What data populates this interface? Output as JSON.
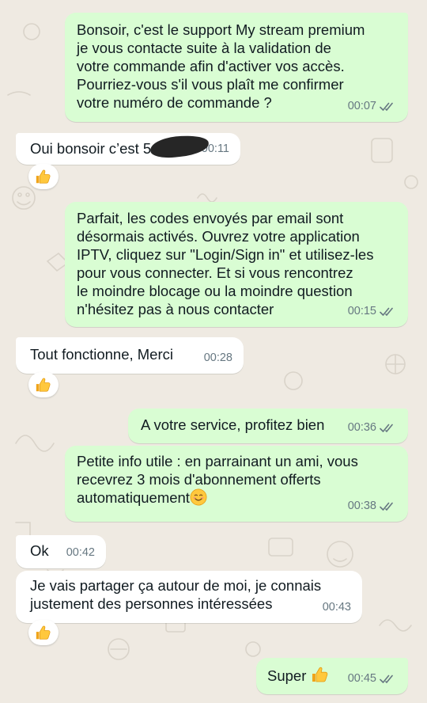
{
  "conversation": {
    "messages": [
      {
        "direction": "outgoing",
        "text": "Bonsoir, c'est le support My stream premium\nje vous contacte suite à la validation de\nvotre commande afin d'activer vos accès.\nPourriez-vous s'il vous plaît me confirmer\nvotre numéro de commande ?",
        "time": "00:07",
        "status": "read"
      },
      {
        "direction": "incoming",
        "text": "Oui bonsoir c’est 5",
        "time": "00:11",
        "reaction": "thumbs-up",
        "redacted": true
      },
      {
        "direction": "outgoing",
        "text": "Parfait, les codes envoyés par email sont\ndésormais activés. Ouvrez votre application\nIPTV, cliquez sur \"Login/Sign in\" et utilisez-les\npour vous connecter. Et si vous rencontrez\nle moindre blocage ou la moindre question\nn'hésitez pas à nous contacter",
        "time": "00:15",
        "status": "read"
      },
      {
        "direction": "incoming",
        "text": "Tout fonctionne, Merci",
        "time": "00:28",
        "reaction": "thumbs-up"
      },
      {
        "direction": "outgoing",
        "text": "A votre service, profitez bien",
        "time": "00:36",
        "status": "read"
      },
      {
        "direction": "outgoing",
        "text": "Petite info utile : en parrainant un ami, vous\nrecevrez 3 mois d'abonnement offerts\nautomatiquement",
        "time": "00:38",
        "status": "read",
        "trailing_emoji": "smiling-face-emoji"
      },
      {
        "direction": "incoming",
        "text": "Ok",
        "time": "00:42"
      },
      {
        "direction": "incoming",
        "text": "Je vais partager ça autour de moi, je connais\njustement des personnes intéressées",
        "time": "00:43",
        "reaction": "thumbs-up"
      },
      {
        "direction": "outgoing",
        "text": "Super",
        "time": "00:45",
        "status": "read",
        "trailing_emoji": "thumbs-up-emoji"
      }
    ]
  },
  "colors": {
    "background": "#efeae2",
    "outgoing_bubble": "#d9fdd3",
    "incoming_bubble": "#ffffff",
    "timestamp": "#667781",
    "read_ticks": "#667781"
  },
  "icons": {
    "delivery_status": "double-check-icon",
    "reaction": "thumbs-up-emoji"
  }
}
